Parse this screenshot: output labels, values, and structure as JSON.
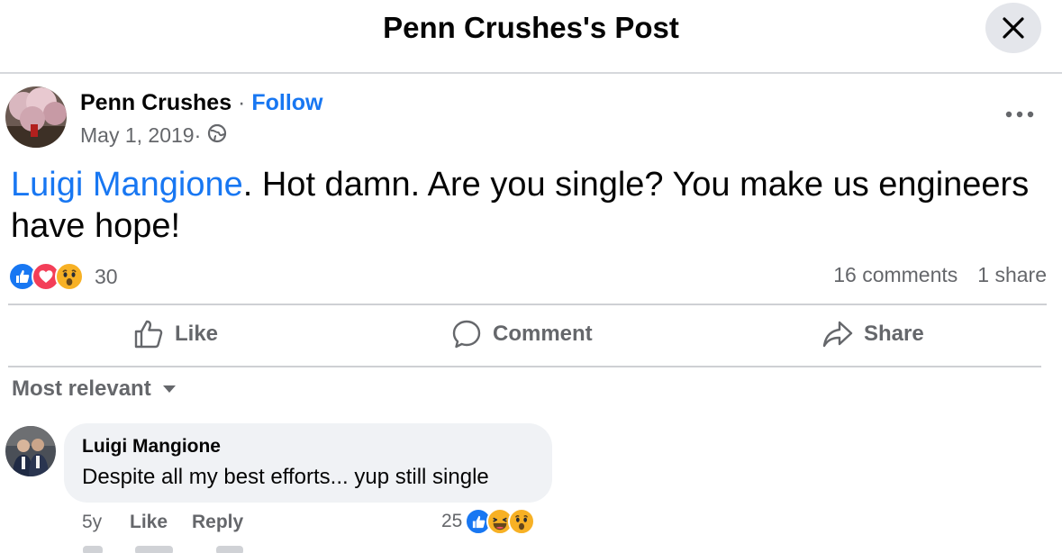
{
  "header": {
    "title": "Penn Crushes's Post"
  },
  "post": {
    "author": "Penn Crushes",
    "separator": " · ",
    "follow_label": "Follow",
    "date": "May 1, 2019",
    "date_separator": " ·",
    "privacy_icon": "globe-icon",
    "mention": "Luigi Mangione",
    "text": ". Hot damn. Are you single? You make us engineers have hope!"
  },
  "reactions": {
    "icons": [
      "like-icon",
      "love-icon",
      "wow-icon"
    ],
    "count": "30",
    "comments": "16 comments",
    "shares": "1 share"
  },
  "actions": {
    "like": "Like",
    "comment": "Comment",
    "share": "Share"
  },
  "sort": {
    "label": "Most relevant"
  },
  "comment": {
    "author": "Luigi Mangione",
    "text": "Despite all my best efforts... yup still single",
    "time": "5y",
    "like_label": "Like",
    "reply_label": "Reply",
    "reaction_count": "25",
    "reaction_icons": [
      "like-icon",
      "haha-icon",
      "wow-icon"
    ]
  },
  "colors": {
    "accent": "#1877f2",
    "secondary_text": "#65676b",
    "bubble": "#f0f2f5",
    "love": "#f33e58",
    "wow": "#f7b125"
  }
}
